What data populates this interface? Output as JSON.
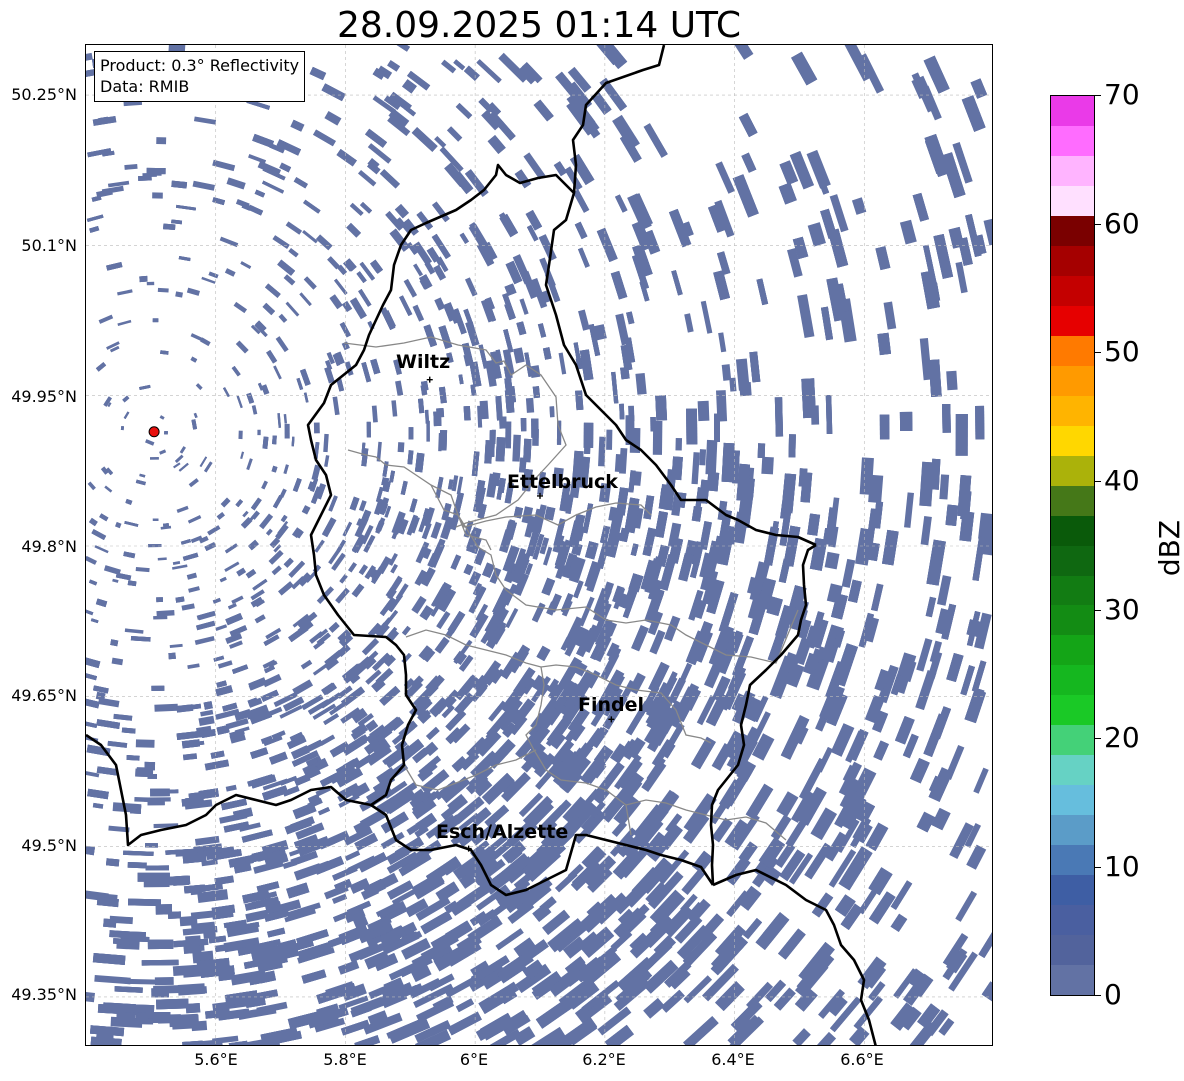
{
  "title": "28.09.2025 01:14 UTC",
  "info": {
    "line1": "Product: 0.3° Reflectivity",
    "line2": "Data: RMIB"
  },
  "colors": {
    "echo": "#6272a4",
    "border": "#000000",
    "district": "#888888",
    "radar_site": "#e8100e",
    "grid": "#bbbbbb"
  },
  "lat_labels": [
    "50.25°N",
    "50.1°N",
    "49.95°N",
    "49.8°N",
    "49.65°N",
    "49.5°N",
    "49.35°N"
  ],
  "lon_labels": [
    "5.6°E",
    "5.8°E",
    "6°E",
    "6.2°E",
    "6.4°E",
    "6.6°E"
  ],
  "cities": [
    {
      "name": "Wiltz",
      "lon": 5.93,
      "lat": 49.966
    },
    {
      "name": "Ettelbruck",
      "lon": 6.1,
      "lat": 49.85
    },
    {
      "name": "Findel",
      "lon": 6.21,
      "lat": 49.627
    },
    {
      "name": "Esch/Alzette",
      "lon": 5.99,
      "lat": 49.498
    }
  ],
  "radar_site": {
    "lon": 5.505,
    "lat": 49.914
  },
  "map_extent": {
    "lon_min": 5.4,
    "lon_max": 6.8,
    "lat_min": 49.3,
    "lat_max": 50.3
  },
  "colorbar": {
    "label": "dBZ",
    "ticks": [
      "0",
      "10",
      "20",
      "30",
      "40",
      "50",
      "60",
      "70"
    ],
    "colors": [
      "#6272a4",
      "#52639c",
      "#4a5fa0",
      "#3e5ea4",
      "#4a79b5",
      "#5b9cc8",
      "#66bedd",
      "#66d2c4",
      "#44d178",
      "#1ac926",
      "#15b71f",
      "#14a517",
      "#138c14",
      "#127c13",
      "#0f6811",
      "#0a5a0a",
      "#457818",
      "#abb20a",
      "#ffd700",
      "#ffb400",
      "#ff9a00",
      "#ff7a00",
      "#e60000",
      "#c40000",
      "#a50000",
      "#7a0000",
      "#ffe0ff",
      "#ffb4ff",
      "#ff6cff",
      "#ea3ae8"
    ]
  }
}
